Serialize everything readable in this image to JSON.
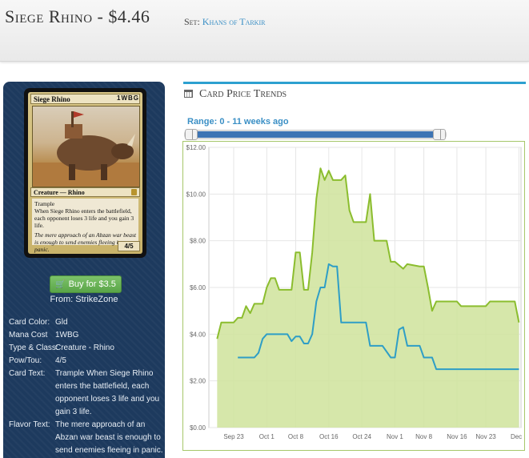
{
  "header": {
    "card_title": "Siege Rhino - $4.46",
    "set_prefix": "Set:",
    "set_name": "Khans of Tarkir"
  },
  "card_image": {
    "name": "Siege Rhino",
    "mana_cost": "1WBG",
    "type_line": "Creature — Rhino",
    "rules_text": [
      "Trample",
      "When Siege Rhino enters the battlefield, each opponent loses 3 life and you gain 3 life."
    ],
    "flavor_text": "The mere approach of an Abzan war beast is enough to send enemies fleeing in panic.",
    "power_toughness": "4/5"
  },
  "buy": {
    "label": "Buy for $3.5",
    "icon": "shopping-cart-icon",
    "from": "From: StrikeZone"
  },
  "details": [
    {
      "key": "Card Color:",
      "value": "Gld"
    },
    {
      "key": "Mana Cost",
      "value": "1WBG"
    },
    {
      "key": "Type & Class:",
      "value": "Creature - Rhino"
    },
    {
      "key": "Pow/Tou:",
      "value": "4/5"
    },
    {
      "key": "Card Text:",
      "value": "Trample When Siege Rhino enters the battlefield, each opponent loses 3 life and you gain 3 life."
    },
    {
      "key": "Flavor Text:",
      "value": "The mere approach of an Abzan war beast is enough to send enemies fleeing in panic."
    }
  ],
  "trends": {
    "title": "Card Price Trends",
    "icon": "calendar-icon",
    "range_label": "Range: 0 - 11 weeks ago",
    "accent_color": "#2da0d0"
  },
  "chart_data": {
    "type": "area",
    "x_ticks": [
      "Sep 23",
      "Oct 1",
      "Oct 8",
      "Oct 16",
      "Oct 24",
      "Nov 1",
      "Nov 8",
      "Nov 16",
      "Nov 23",
      "Dec 1"
    ],
    "y_ticks": [
      "$0.00",
      "$2.00",
      "$4.00",
      "$6.00",
      "$8.00",
      "$10.00",
      "$12.00"
    ],
    "ylim": [
      0,
      12
    ],
    "grid": true,
    "series": [
      {
        "color": "#8bbd2e",
        "fill": "#cfe39b",
        "points": [
          [
            "2014-09-19",
            3.8
          ],
          [
            "2014-09-20",
            4.5
          ],
          [
            "2014-09-23",
            4.5
          ],
          [
            "2014-09-24",
            4.7
          ],
          [
            "2014-09-25",
            4.7
          ],
          [
            "2014-09-26",
            5.2
          ],
          [
            "2014-09-27",
            4.9
          ],
          [
            "2014-09-28",
            5.3
          ],
          [
            "2014-09-30",
            5.3
          ],
          [
            "2014-10-01",
            6.0
          ],
          [
            "2014-10-02",
            6.4
          ],
          [
            "2014-10-03",
            6.4
          ],
          [
            "2014-10-04",
            5.9
          ],
          [
            "2014-10-07",
            5.9
          ],
          [
            "2014-10-08",
            7.5
          ],
          [
            "2014-10-09",
            7.5
          ],
          [
            "2014-10-10",
            5.9
          ],
          [
            "2014-10-11",
            5.9
          ],
          [
            "2014-10-12",
            7.5
          ],
          [
            "2014-10-13",
            9.8
          ],
          [
            "2014-10-14",
            11.1
          ],
          [
            "2014-10-15",
            10.6
          ],
          [
            "2014-10-16",
            11.0
          ],
          [
            "2014-10-17",
            10.6
          ],
          [
            "2014-10-19",
            10.6
          ],
          [
            "2014-10-20",
            10.8
          ],
          [
            "2014-10-21",
            9.3
          ],
          [
            "2014-10-22",
            8.8
          ],
          [
            "2014-10-25",
            8.8
          ],
          [
            "2014-10-26",
            10.0
          ],
          [
            "2014-10-27",
            8.0
          ],
          [
            "2014-10-30",
            8.0
          ],
          [
            "2014-10-31",
            7.1
          ],
          [
            "2014-11-01",
            7.1
          ],
          [
            "2014-11-03",
            6.8
          ],
          [
            "2014-11-04",
            7.0
          ],
          [
            "2014-11-07",
            6.9
          ],
          [
            "2014-11-08",
            6.9
          ],
          [
            "2014-11-09",
            6.0
          ],
          [
            "2014-11-10",
            5.0
          ],
          [
            "2014-11-11",
            5.4
          ],
          [
            "2014-11-16",
            5.4
          ],
          [
            "2014-11-17",
            5.2
          ],
          [
            "2014-11-23",
            5.2
          ],
          [
            "2014-11-24",
            5.4
          ],
          [
            "2014-11-30",
            5.4
          ],
          [
            "2014-12-01",
            4.5
          ]
        ]
      },
      {
        "color": "#2e9ec6",
        "points": [
          [
            "2014-09-24",
            3.0
          ],
          [
            "2014-09-28",
            3.0
          ],
          [
            "2014-09-29",
            3.2
          ],
          [
            "2014-09-30",
            3.8
          ],
          [
            "2014-10-01",
            4.0
          ],
          [
            "2014-10-06",
            4.0
          ],
          [
            "2014-10-07",
            3.7
          ],
          [
            "2014-10-08",
            3.9
          ],
          [
            "2014-10-09",
            3.9
          ],
          [
            "2014-10-10",
            3.6
          ],
          [
            "2014-10-11",
            3.6
          ],
          [
            "2014-10-12",
            4.0
          ],
          [
            "2014-10-13",
            5.4
          ],
          [
            "2014-10-14",
            6.0
          ],
          [
            "2014-10-15",
            6.0
          ],
          [
            "2014-10-16",
            7.0
          ],
          [
            "2014-10-17",
            6.9
          ],
          [
            "2014-10-18",
            6.9
          ],
          [
            "2014-10-19",
            4.5
          ],
          [
            "2014-10-25",
            4.5
          ],
          [
            "2014-10-26",
            3.5
          ],
          [
            "2014-10-29",
            3.5
          ],
          [
            "2014-10-31",
            3.0
          ],
          [
            "2014-11-01",
            3.0
          ],
          [
            "2014-11-02",
            4.2
          ],
          [
            "2014-11-03",
            4.3
          ],
          [
            "2014-11-04",
            3.5
          ],
          [
            "2014-11-07",
            3.5
          ],
          [
            "2014-11-08",
            3.0
          ],
          [
            "2014-11-10",
            3.0
          ],
          [
            "2014-11-11",
            2.5
          ],
          [
            "2014-12-01",
            2.5
          ]
        ]
      }
    ]
  }
}
